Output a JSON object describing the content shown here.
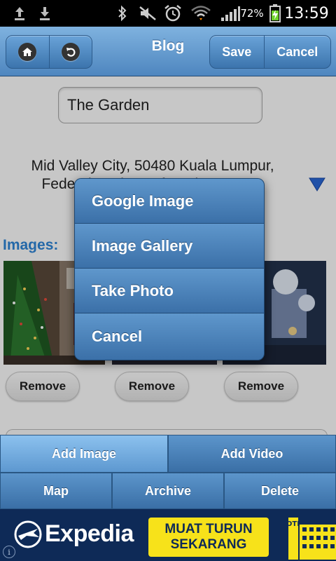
{
  "status_bar": {
    "battery_percent": "72%",
    "time": "13:59"
  },
  "header": {
    "title": "Blog",
    "save_label": "Save",
    "cancel_label": "Cancel",
    "accent": "#4e86bf"
  },
  "form": {
    "title_value": "The Garden",
    "address_lines": [
      "Mid Valley City, 50480 Kuala Lumpur,",
      "Federal Territory of Kuala Lumpur,"
    ]
  },
  "images": {
    "label": "Images:",
    "remove_label": "Remove"
  },
  "popup": {
    "items": [
      "Google Image",
      "Image Gallery",
      "Take Photo",
      "Cancel"
    ]
  },
  "nav": {
    "row1": [
      "Add Image",
      "Add Video"
    ],
    "row2": [
      "Map",
      "Archive",
      "Delete"
    ]
  },
  "ad": {
    "brand": "Expedia",
    "cta_line1": "MUAT TURUN",
    "cta_line2": "SEKARANG",
    "hotel_text": "HOTEL",
    "info": "i"
  }
}
